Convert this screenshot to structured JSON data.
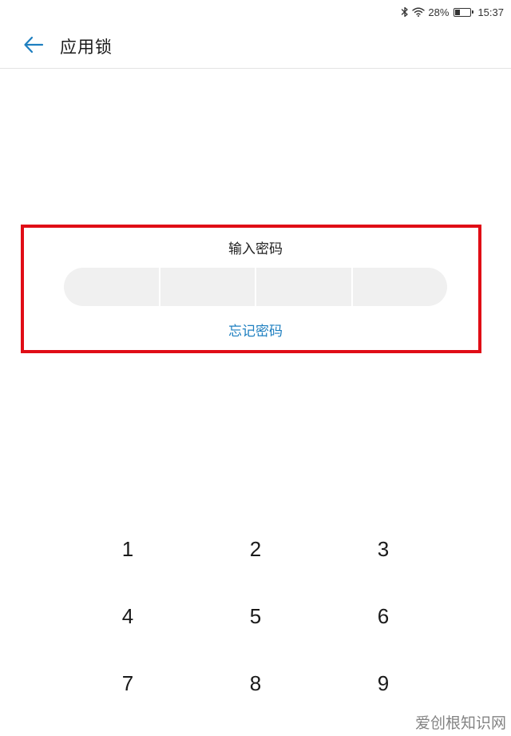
{
  "status_bar": {
    "battery_percent": "28%",
    "battery_level": 0.28,
    "time": "15:37",
    "icons": [
      "bluetooth-icon",
      "wifi-icon",
      "battery-icon"
    ]
  },
  "header": {
    "back_icon": "back-arrow-icon",
    "title": "应用锁"
  },
  "lock": {
    "prompt": "输入密码",
    "pin_length": 4,
    "forgot_label": "忘记密码"
  },
  "keypad": {
    "rows": [
      [
        "1",
        "2",
        "3"
      ],
      [
        "4",
        "5",
        "6"
      ],
      [
        "7",
        "8",
        "9"
      ]
    ]
  },
  "watermark": "爱创根知识网",
  "colors": {
    "accent": "#1e7fc0",
    "highlight": "#e00d16",
    "pin_bg": "#f0f0f0"
  }
}
